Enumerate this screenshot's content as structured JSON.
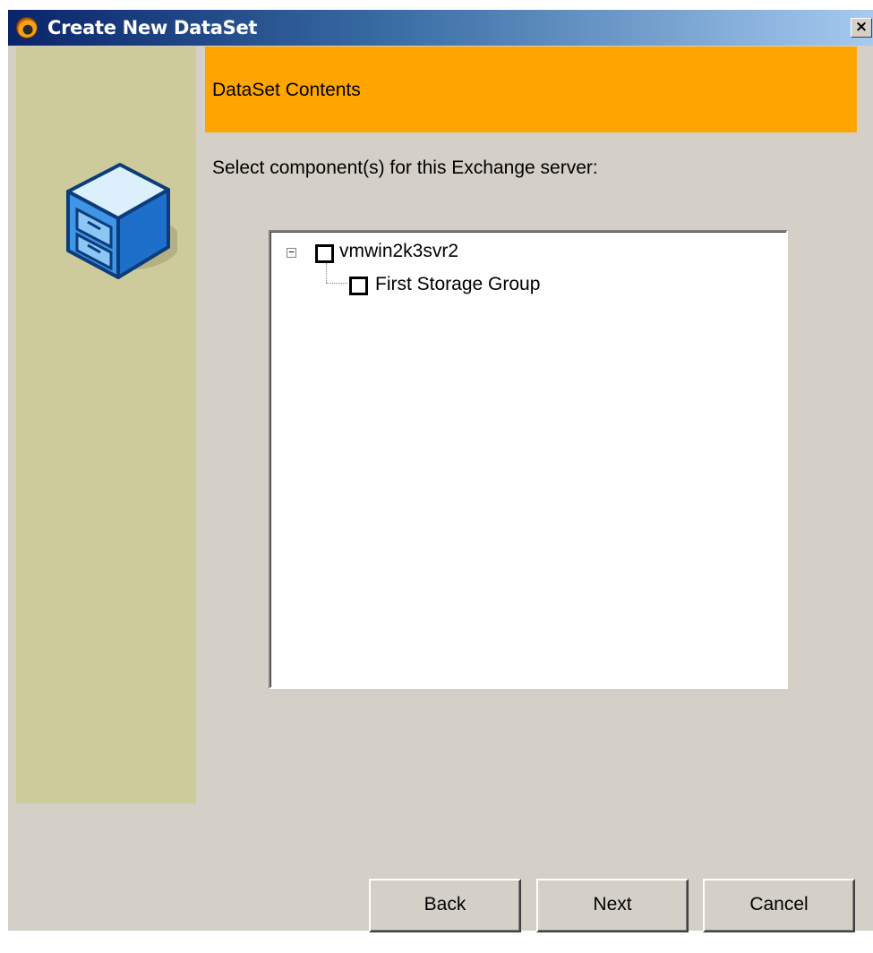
{
  "window": {
    "title": "Create New DataSet",
    "close_label": "×"
  },
  "header": {
    "title": "DataSet Contents"
  },
  "instruction": "Select component(s) for this Exchange server:",
  "tree": {
    "root": {
      "label": "vmwin2k3svr2",
      "expanded": true,
      "checked": false,
      "expander_glyph": "−"
    },
    "children": [
      {
        "label": "First Storage Group",
        "checked": false
      }
    ]
  },
  "buttons": {
    "back": "Back",
    "next": "Next",
    "cancel": "Cancel"
  },
  "colors": {
    "title_gradient_start": "#0a246a",
    "title_gradient_end": "#a6caf0",
    "header_band": "#ffa500",
    "side_panel": "#cdca9b",
    "dialog_bg": "#d4d0c8"
  },
  "icons": {
    "app": "app-logo-icon",
    "side": "file-cabinet-icon"
  }
}
